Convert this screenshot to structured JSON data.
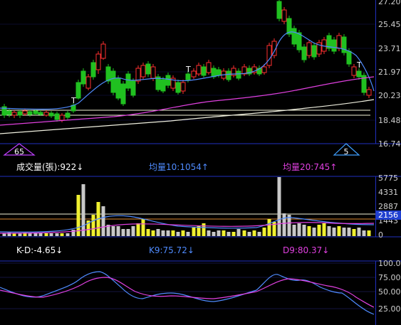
{
  "price_panel": {
    "y_ticks": [
      "27.20",
      "25.45",
      "23.71",
      "21.97",
      "20.23",
      "18.48",
      "16.74"
    ],
    "left_marker": "65",
    "right_marker": "5",
    "candle_note": "T"
  },
  "volume_header": {
    "volume_label": "成交量(張):922↓",
    "ma10_label": "均量10:1054↑",
    "ma20_label": "均量20:745↑"
  },
  "volume_panel": {
    "y_ticks": [
      "5775",
      "4331",
      "2887",
      "1443",
      "0"
    ],
    "current_value": "2156"
  },
  "kd_header": {
    "kd_label": "K-D:-4.65↓",
    "k_label": "K9:75.72↓",
    "d_label": "D9:80.37↓"
  },
  "kd_panel": {
    "y_ticks": [
      "100.00",
      "75.00",
      "50.00",
      "25.00"
    ]
  },
  "colors": {
    "background": "#000000",
    "up": "#ff3030",
    "down": "#20c020",
    "ma_short": "#4f8bff",
    "ma_mid": "#e040e0",
    "ma_long": "#f0f0e0",
    "grid": "#2030c0",
    "header_white": "#ffffff",
    "header_blue": "#4f8bff",
    "header_magenta": "#e040e0"
  }
}
